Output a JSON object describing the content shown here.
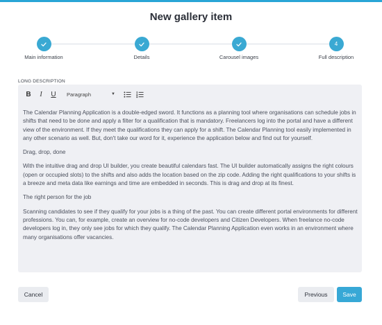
{
  "title": "New gallery item",
  "stepper": {
    "steps": [
      {
        "label": "Main information",
        "state": "done",
        "marker": "check"
      },
      {
        "label": "Details",
        "state": "done",
        "marker": "check"
      },
      {
        "label": "Carousel images",
        "state": "done",
        "marker": "check"
      },
      {
        "label": "Full description",
        "state": "current",
        "marker": "4"
      }
    ]
  },
  "editor": {
    "label": "LONG DESCRIPTION",
    "toolbar": {
      "bold": "B",
      "italic": "I",
      "underline": "U",
      "format_select": "Paragraph"
    },
    "paragraphs": [
      "The Calendar Planning Application is a double-edged sword. It functions as a planning tool where organisations can schedule jobs in shifts that need to be done and apply a filter for a qualification that is mandatory. Freelancers log into the portal and have a different view of the environment. If they meet the qualifications they can apply for a shift. The Calendar Planning tool easily implemented in any other scenario as well. But, don't take our word for it, experience the application below and find out for yourself.",
      "Drag, drop, done",
      "With the intuitive drag and drop UI builder, you create beautiful calendars fast. The UI builder automatically assigns the right colours (open or occupied slots) to the shifts and also adds the location based on the zip code. Adding the right qualifications to your shifts is a breeze and meta data like earnings and time are embedded in seconds. This is drag and drop at its finest.",
      "The right person for the job",
      "Scanning candidates to see if they qualify for your jobs is a thing of the past. You can create different portal environments for different professions. You can, for example, create an overview for no-code developers and Citizen Developers. When freelance no-code developers log in, they only see jobs for which they qualify. The Calendar Planning Application even works in an environment where many organisations offer vacancies."
    ]
  },
  "actions": {
    "cancel": "Cancel",
    "previous": "Previous",
    "save": "Save"
  },
  "colors": {
    "accent": "#37a8d6",
    "editor_bg": "#eff0f4",
    "secondary_button": "#eaecf0"
  }
}
